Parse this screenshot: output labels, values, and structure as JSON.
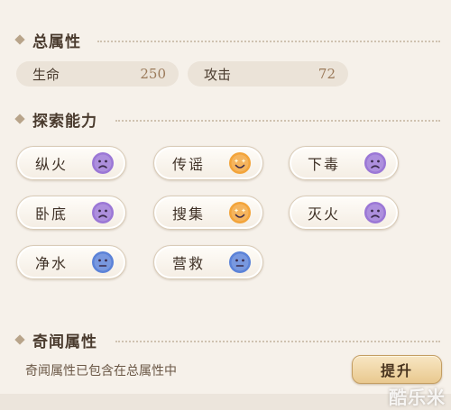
{
  "total_attributes": {
    "title": "总属性",
    "stats": [
      {
        "label": "生命",
        "value": "250"
      },
      {
        "label": "攻击",
        "value": "72"
      }
    ]
  },
  "exploration": {
    "title": "探索能力",
    "abilities": [
      {
        "label": "纵火",
        "mood": "sad",
        "color": "#9b77d6"
      },
      {
        "label": "传谣",
        "mood": "happy",
        "color": "#f3a43a"
      },
      {
        "label": "下毒",
        "mood": "sad",
        "color": "#9b77d6"
      },
      {
        "label": "卧底",
        "mood": "sad",
        "color": "#9b77d6"
      },
      {
        "label": "搜集",
        "mood": "happy",
        "color": "#f3a43a"
      },
      {
        "label": "灭火",
        "mood": "sad",
        "color": "#9b77d6"
      },
      {
        "label": "净水",
        "mood": "neutral",
        "color": "#5b82d8"
      },
      {
        "label": "营救",
        "mood": "neutral",
        "color": "#5b82d8"
      }
    ]
  },
  "anecdote": {
    "title": "奇闻属性",
    "note": "奇闻属性已包含在总属性中",
    "upgrade_label": "提升"
  },
  "watermark": "酷乐米"
}
